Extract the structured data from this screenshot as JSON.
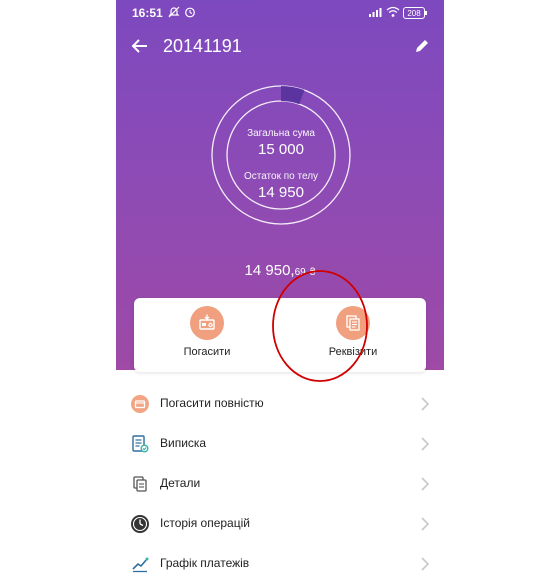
{
  "status": {
    "time": "16:51",
    "battery": "208"
  },
  "appbar": {
    "title": "20141191",
    "back_icon": "arrow-left-icon",
    "edit_icon": "pencil-icon"
  },
  "loan": {
    "total_label": "Загальна сума",
    "total_value": "15 000",
    "remaining_label": "Остаток по телу",
    "remaining_value": "14 950",
    "balance_main": "14 950,",
    "balance_cents": "69",
    "currency": "₴",
    "paid_fraction": 0.0033
  },
  "actions": {
    "pay": {
      "label": "Погасити",
      "icon": "card-payment-icon"
    },
    "details": {
      "label": "Реквізити",
      "icon": "documents-icon"
    }
  },
  "menu": [
    {
      "label": "Погасити повністю",
      "icon": "wallet-icon"
    },
    {
      "label": "Виписка",
      "icon": "statement-icon"
    },
    {
      "label": "Детали",
      "icon": "copy-icon"
    },
    {
      "label": "Історія операцій",
      "icon": "clock-icon"
    },
    {
      "label": "Графік платежів",
      "icon": "chart-icon"
    }
  ],
  "colors": {
    "hero_top": "#7d49bf",
    "hero_bottom": "#9e4aa6",
    "accent_orange": "#f0a07f",
    "annotation_red": "#d00000",
    "ring_progress": "#5b34a0"
  }
}
